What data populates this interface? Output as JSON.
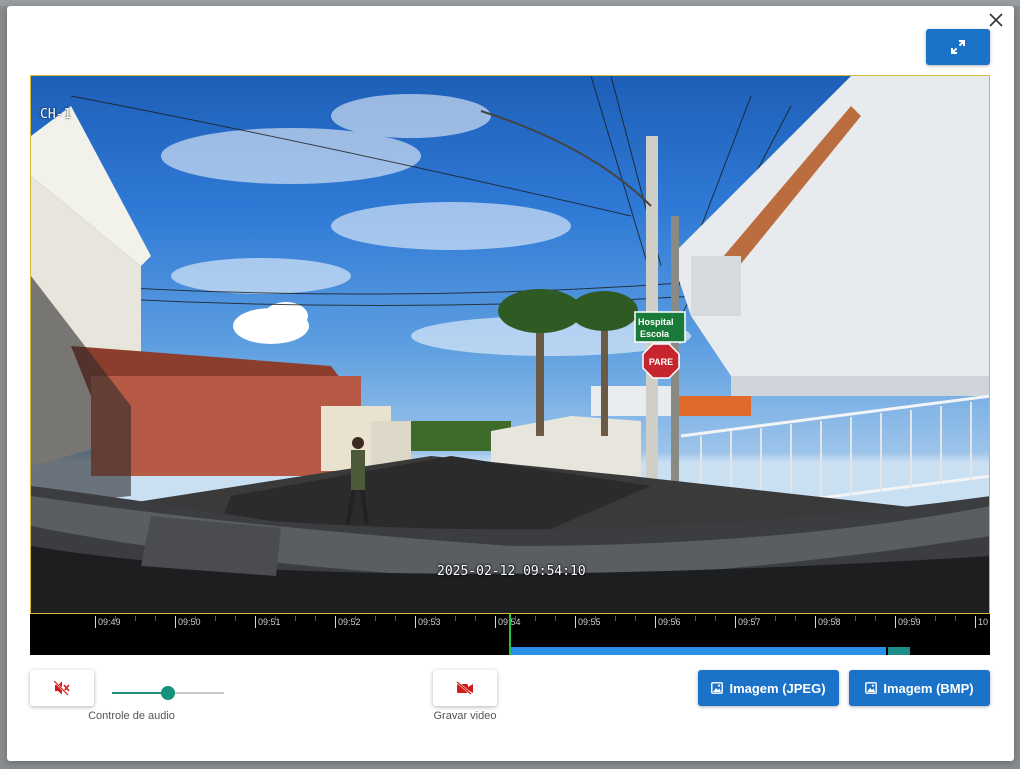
{
  "video": {
    "channel": "CH-1",
    "timestamp": "2025-02-12 09:54:10",
    "scene": {
      "sign_street_line1": "Hospital",
      "sign_street_line2": "Escola",
      "sign_stop": "PARE"
    }
  },
  "timeline": {
    "ticks": [
      "09:49",
      "09:50",
      "09:51",
      "09:52",
      "09:53",
      "09:54",
      "09:55",
      "09:56",
      "09:57",
      "09:58",
      "09:59",
      "10"
    ],
    "playhead_time": "09:54:10"
  },
  "controls": {
    "audio_caption": "Controle de audio",
    "audio_volume_fraction": 0.5,
    "record_caption": "Gravar video",
    "jpeg_label": "Imagem (JPEG)",
    "bmp_label": "Imagem (BMP)"
  },
  "icons": {
    "close": "close-icon",
    "fullscreen": "expand-icon",
    "mute": "volume-mute-icon",
    "record": "video-off-icon",
    "image": "image-icon"
  },
  "colors": {
    "primary": "#1a73c8",
    "accent_red": "#d11a1a",
    "slider": "#14927d",
    "playhead": "#23c443",
    "recorded": "#2a8fe6",
    "video_border": "#d9b73b"
  }
}
